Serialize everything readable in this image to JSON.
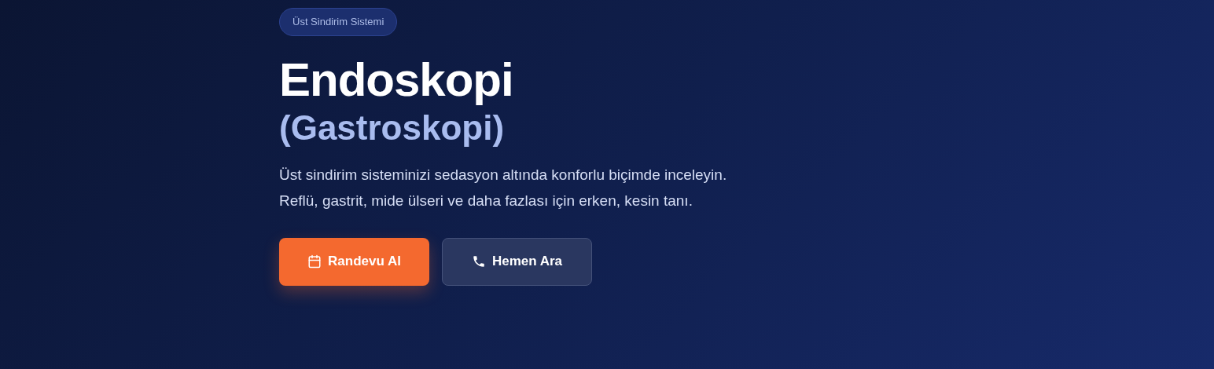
{
  "badge": "Üst Sindirim Sistemi",
  "title": "Endoskopi",
  "subtitle": "(Gastroskopi)",
  "description": [
    "Üst sindirim sisteminizi sedasyon altında konforlu biçimde inceleyin.",
    "Reflü, gastrit, mide ülseri ve daha fazlası için erken, kesin tanı."
  ],
  "buttons": [
    {
      "label": "Randevu Al",
      "kind": "primary"
    },
    {
      "label": "Hemen Ara",
      "kind": "secondary"
    }
  ]
}
